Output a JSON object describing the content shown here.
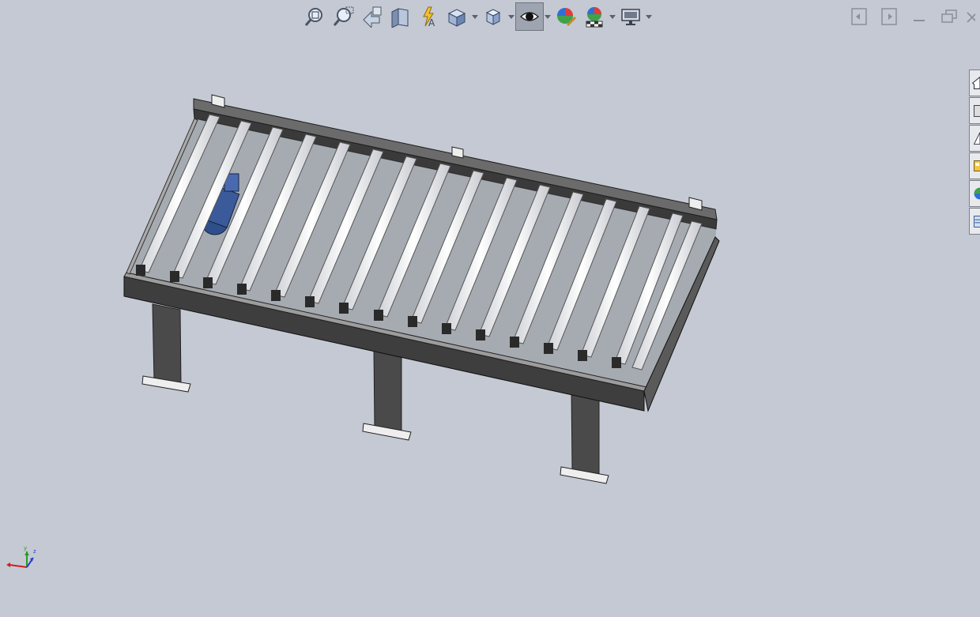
{
  "app": {
    "type": "3D CAD viewport"
  },
  "heads_up_toolbar": [
    {
      "id": "zoom-to-fit",
      "icon": "zoom-to-fit-icon"
    },
    {
      "id": "zoom-to-area",
      "icon": "zoom-to-area-icon"
    },
    {
      "id": "previous-view",
      "icon": "previous-view-icon"
    },
    {
      "id": "section-view",
      "icon": "section-view-icon"
    },
    {
      "id": "dynamic-annotation",
      "icon": "dynamic-annotation-icon"
    },
    {
      "id": "view-orientation",
      "icon": "view-orientation-icon",
      "dropdown": true
    },
    {
      "id": "display-style",
      "icon": "display-style-icon",
      "dropdown": true
    },
    {
      "id": "hide-show-items",
      "icon": "hide-show-items-icon",
      "dropdown": true,
      "active": true
    },
    {
      "id": "edit-appearance",
      "icon": "edit-appearance-icon"
    },
    {
      "id": "apply-scene",
      "icon": "apply-scene-icon",
      "dropdown": true
    },
    {
      "id": "view-settings",
      "icon": "view-settings-icon",
      "dropdown": true
    }
  ],
  "window_controls": [
    "tile-left-icon",
    "tile-right-icon",
    "minimize-icon",
    "restore-icon",
    "close-icon"
  ],
  "task_pane_tabs": [
    "home-icon",
    "design-library-icon",
    "file-explorer-icon",
    "view-palette-icon",
    "appearances-icon",
    "custom-properties-icon"
  ],
  "colors": {
    "background": "#c4c9d3",
    "roller": "#f4f4f6",
    "frame": "#3c3c3c",
    "motor": "#3a5a9a"
  },
  "triad_axes": [
    "x",
    "y",
    "z"
  ]
}
